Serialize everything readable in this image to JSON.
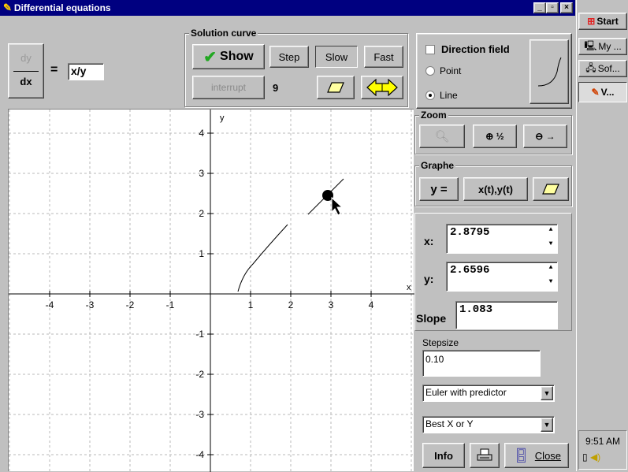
{
  "window": {
    "title": "Differential equations",
    "controls": [
      "_",
      "▫",
      "×"
    ]
  },
  "equation": {
    "dy": "dy",
    "dx": "dx",
    "equals": "=",
    "expression": "x/y"
  },
  "solution_curve": {
    "label": "Solution curve",
    "show": "Show",
    "step": "Step",
    "slow": "Slow",
    "fast": "Fast",
    "interrupt": "interrupt",
    "count": "9"
  },
  "direction_field": {
    "label": "Direction field",
    "point": "Point",
    "line": "Line",
    "selected": "Line",
    "checked": false
  },
  "zoom": {
    "label": "Zoom"
  },
  "graphe": {
    "label": "Graphe",
    "y_eq": "y =",
    "xt_yt": "x(t),y(t)"
  },
  "values": {
    "x_label": "x:",
    "x_value": "2.8795",
    "y_label": "y:",
    "y_value": "2.6596",
    "slope_label": "Slope",
    "slope_value": "1.083"
  },
  "stepsize": {
    "label": "Stepsize",
    "value": "0.10"
  },
  "method": {
    "selected": "Euler with predictor"
  },
  "best": {
    "selected": "Best X or Y"
  },
  "footer": {
    "info": "Info",
    "close": "Close"
  },
  "graph": {
    "x_axis_label": "x",
    "y_axis_label": "y",
    "x_ticks": [
      "-4",
      "-3",
      "-2",
      "-1",
      "1",
      "2",
      "3",
      "4"
    ],
    "y_ticks": [
      "4",
      "3",
      "2",
      "1",
      "-1",
      "-2",
      "-3",
      "-4"
    ]
  },
  "taskbar": {
    "start": "Start",
    "items": [
      "My ...",
      "Sof...",
      "V..."
    ],
    "clock": "9:51 AM"
  }
}
